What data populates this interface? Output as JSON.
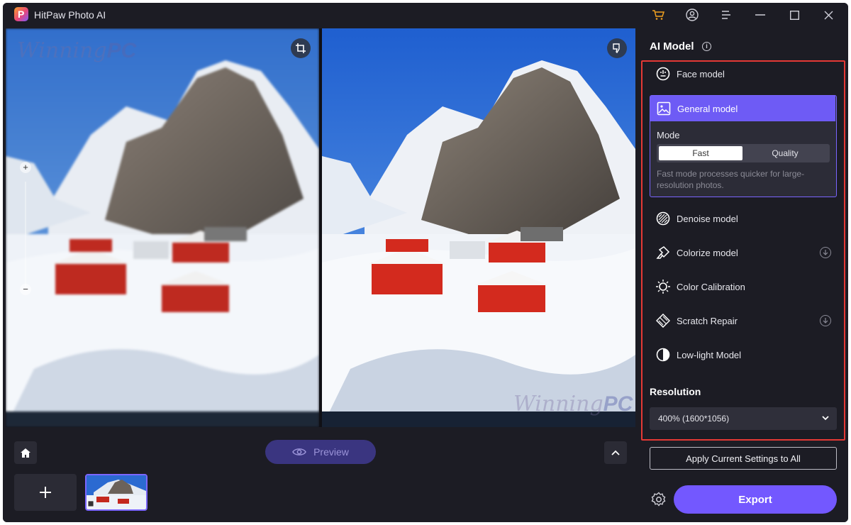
{
  "app": {
    "title": "HitPaw Photo AI",
    "logo_letter": "P"
  },
  "titlebar": {
    "icons": [
      "cart-icon",
      "account-icon",
      "menu-icon",
      "minimize-icon",
      "maximize-icon",
      "close-icon"
    ]
  },
  "stage": {
    "watermark_left": "Winning",
    "watermark_left_bold": "PC",
    "watermark_right": "Winning",
    "watermark_right_bold": "PC",
    "zoom_in": "+",
    "zoom_out": "−"
  },
  "bottom": {
    "preview_label": "Preview"
  },
  "panel": {
    "title": "AI Model",
    "models": [
      {
        "label": "Face model",
        "icon": "face-icon"
      },
      {
        "label": "General model",
        "icon": "image-icon"
      },
      {
        "label": "Denoise model",
        "icon": "denoise-icon"
      },
      {
        "label": "Colorize model",
        "icon": "colorize-icon",
        "download": true
      },
      {
        "label": "Color Calibration",
        "icon": "sun-icon"
      },
      {
        "label": "Scratch Repair",
        "icon": "scratch-icon",
        "download": true
      },
      {
        "label": "Low-light Model",
        "icon": "half-moon-icon"
      }
    ],
    "general": {
      "mode_label": "Mode",
      "mode_options": [
        "Fast",
        "Quality"
      ],
      "selected_mode": "Fast",
      "description": "Fast mode processes quicker for large-resolution photos."
    },
    "resolution": {
      "title": "Resolution",
      "value": "400% (1600*1056)"
    },
    "apply_label": "Apply Current Settings to All",
    "export_label": "Export"
  },
  "colors": {
    "accent": "#7358ff",
    "highlight": "#e53935",
    "bg": "#1c1c24"
  }
}
